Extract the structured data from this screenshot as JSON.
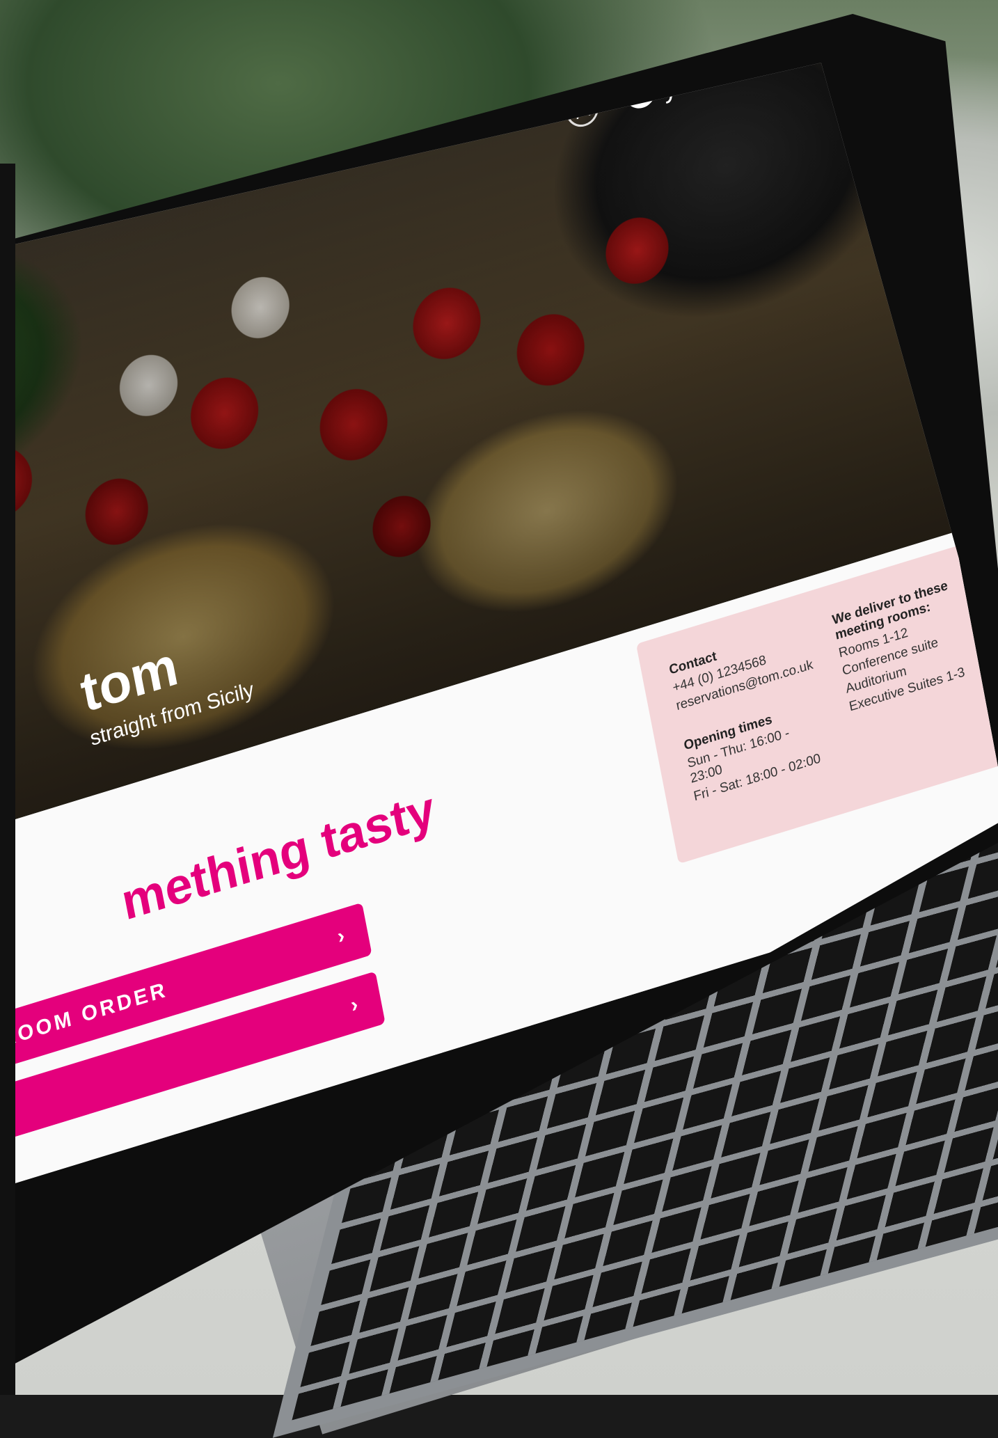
{
  "header": {
    "powered_by": "powered by",
    "brand": "yonoton",
    "account_icon": "user-icon",
    "brand_icon": "yonoton-logo-icon"
  },
  "hero": {
    "title": "tom",
    "subtitle": "straight from Sicily"
  },
  "main": {
    "tagline": "mething tasty",
    "buttons": [
      {
        "label": "ROOM ORDER",
        "icon": "chevron-right-icon"
      },
      {
        "label": "",
        "icon": "chevron-right-icon"
      }
    ]
  },
  "info": {
    "contact": {
      "heading": "Contact",
      "phone": "+44 (0) 1234568",
      "email": "reservations@tom.co.uk"
    },
    "opening": {
      "heading": "Opening times",
      "line1": "Sun - Thu: 16:00 - 23:00",
      "line2": "Fri - Sat: 18:00 - 02:00"
    },
    "delivery": {
      "heading": "We deliver to these meeting rooms:",
      "rooms": [
        "Rooms 1-12",
        "Conference suite",
        "Auditorium",
        "Executive Suites 1-3"
      ]
    }
  },
  "colors": {
    "accent": "#e4007c",
    "info_bg": "#f4d6d9"
  }
}
